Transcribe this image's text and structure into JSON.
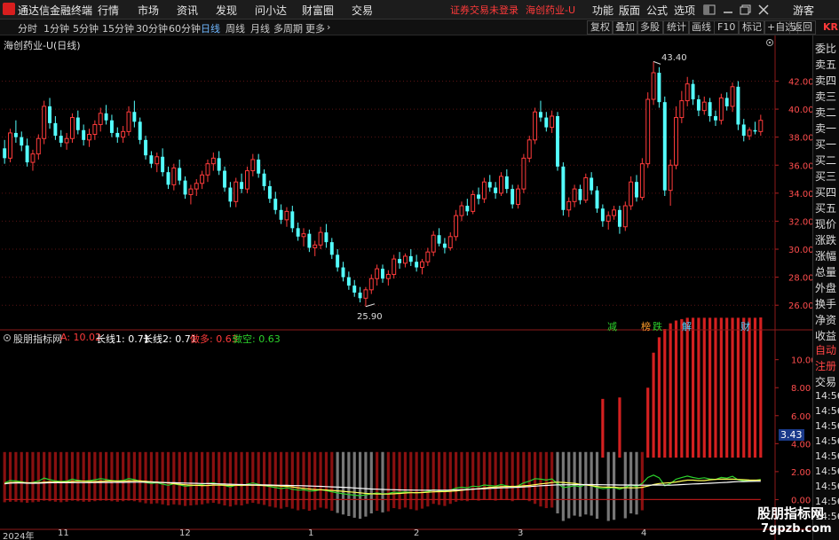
{
  "menubar": {
    "app_title": "通达信金融终端",
    "menus": [
      "行情",
      "市场",
      "资讯",
      "发现",
      "问小达",
      "财富圈",
      "交易"
    ],
    "status": "证券交易未登录",
    "stock_name": "海创药业-U",
    "right_menus": [
      "功能",
      "版面",
      "公式",
      "选项"
    ],
    "guest": "游客",
    "brand_color": "#d81e1e"
  },
  "periodbar": {
    "periods": [
      "分时",
      "1分钟",
      "5分钟",
      "15分钟",
      "30分钟",
      "60分钟",
      "日线",
      "周线",
      "月线",
      "多周期",
      "更多"
    ],
    "active_period": "日线",
    "tools": [
      "复权",
      "叠加",
      "多股",
      "统计",
      "画线",
      "F10",
      "标记",
      "+自选",
      "返回"
    ],
    "kr": "KR"
  },
  "main_chart": {
    "title": "海创药业-U(日线)",
    "high_label": "43.40",
    "low_label": "25.90",
    "event_markers": [
      "减",
      "榜",
      "跌",
      "解",
      "财"
    ],
    "up_color": "#ff3b3b",
    "down_color": "#54ffff"
  },
  "indicator": {
    "name": "股朋指标网",
    "a_label": "A: 10.02",
    "long1_label": "长线1: 0.71",
    "long2_label": "长线2: 0.71",
    "long_label": "做多: 0.63",
    "short_label": "做空: 0.63",
    "current_value": "3.43"
  },
  "x_axis": {
    "year": "2024年",
    "months": [
      "11",
      "12",
      "1",
      "2",
      "3",
      "4"
    ]
  },
  "right_panel": {
    "rows": [
      "委比",
      "卖五",
      "卖四",
      "卖三",
      "卖二",
      "卖一",
      "买一",
      "买二",
      "买三",
      "买四",
      "买五",
      "现价",
      "涨跌",
      "涨幅",
      "总量",
      "外盘",
      "换手",
      "净资",
      "收益",
      "自动",
      "注册",
      "交易",
      "14:56",
      "14:56",
      "14:56",
      "14:56",
      "14:56",
      "14:56",
      "14:56",
      "14:56",
      "14:56"
    ]
  },
  "watermark": {
    "line1": "股朋指标网",
    "line2": "7gpzb.com"
  },
  "chart_data": {
    "type": "candlestick",
    "price_axis": {
      "ticks": [
        26.0,
        28.0,
        30.0,
        32.0,
        34.0,
        36.0,
        38.0,
        40.0,
        42.0
      ],
      "ylim": [
        25.0,
        44.5
      ]
    },
    "indicator_axis": {
      "ticks": [
        0.0,
        2.0,
        4.0,
        6.0,
        8.0,
        10.0
      ],
      "ylim": [
        -2.0,
        11.5
      ]
    },
    "candles": [
      [
        37.2,
        37.8,
        36.1,
        36.5
      ],
      [
        36.5,
        38.6,
        36.2,
        38.3
      ],
      [
        38.3,
        39.2,
        37.6,
        38.0
      ],
      [
        38.0,
        38.4,
        37.0,
        37.4
      ],
      [
        37.4,
        37.9,
        35.9,
        36.2
      ],
      [
        36.2,
        37.1,
        35.6,
        36.8
      ],
      [
        36.8,
        38.2,
        36.4,
        37.9
      ],
      [
        37.9,
        40.6,
        37.5,
        40.2
      ],
      [
        40.2,
        40.8,
        38.6,
        39.0
      ],
      [
        39.0,
        39.5,
        37.8,
        38.1
      ],
      [
        38.1,
        38.5,
        37.3,
        37.6
      ],
      [
        37.6,
        38.3,
        37.1,
        37.9
      ],
      [
        37.9,
        39.7,
        37.6,
        39.4
      ],
      [
        39.4,
        39.9,
        38.2,
        38.5
      ],
      [
        38.5,
        38.9,
        37.4,
        37.8
      ],
      [
        37.8,
        38.6,
        37.3,
        38.2
      ],
      [
        38.2,
        39.2,
        37.8,
        38.9
      ],
      [
        38.9,
        40.1,
        38.4,
        39.7
      ],
      [
        39.7,
        40.3,
        38.9,
        39.2
      ],
      [
        39.2,
        39.6,
        38.0,
        38.3
      ],
      [
        38.3,
        38.7,
        37.6,
        38.0
      ],
      [
        38.0,
        38.8,
        37.6,
        38.4
      ],
      [
        38.4,
        40.2,
        38.1,
        39.8
      ],
      [
        39.8,
        40.6,
        38.7,
        39.1
      ],
      [
        39.1,
        39.4,
        37.5,
        37.8
      ],
      [
        37.8,
        38.1,
        36.4,
        36.7
      ],
      [
        36.7,
        37.0,
        35.8,
        36.1
      ],
      [
        36.1,
        36.9,
        35.5,
        36.6
      ],
      [
        36.6,
        37.2,
        35.2,
        35.5
      ],
      [
        35.5,
        35.9,
        34.3,
        34.6
      ],
      [
        34.6,
        36.1,
        34.2,
        35.8
      ],
      [
        35.8,
        36.4,
        34.6,
        34.9
      ],
      [
        34.9,
        35.2,
        33.6,
        33.9
      ],
      [
        33.9,
        34.6,
        33.2,
        34.3
      ],
      [
        34.3,
        35.0,
        33.8,
        34.7
      ],
      [
        34.7,
        35.6,
        34.3,
        35.3
      ],
      [
        35.3,
        36.4,
        34.8,
        36.1
      ],
      [
        36.1,
        36.9,
        35.6,
        36.5
      ],
      [
        36.5,
        37.0,
        35.3,
        35.6
      ],
      [
        35.6,
        35.9,
        34.1,
        34.4
      ],
      [
        34.4,
        34.8,
        33.0,
        33.4
      ],
      [
        33.4,
        35.1,
        33.0,
        34.8
      ],
      [
        34.8,
        35.4,
        34.0,
        34.3
      ],
      [
        34.3,
        35.9,
        34.0,
        35.6
      ],
      [
        35.6,
        36.8,
        35.2,
        36.4
      ],
      [
        36.4,
        36.8,
        35.1,
        35.4
      ],
      [
        35.4,
        35.7,
        34.2,
        34.5
      ],
      [
        34.5,
        34.9,
        33.3,
        33.6
      ],
      [
        33.6,
        34.1,
        32.5,
        32.8
      ],
      [
        32.8,
        33.2,
        31.8,
        32.1
      ],
      [
        32.1,
        33.0,
        31.6,
        32.7
      ],
      [
        32.7,
        33.1,
        31.2,
        31.5
      ],
      [
        31.5,
        31.9,
        30.6,
        30.9
      ],
      [
        30.9,
        31.5,
        30.2,
        31.1
      ],
      [
        31.1,
        31.4,
        29.8,
        30.1
      ],
      [
        30.1,
        30.6,
        29.5,
        30.3
      ],
      [
        30.3,
        31.6,
        30.0,
        31.2
      ],
      [
        31.2,
        31.8,
        30.1,
        30.5
      ],
      [
        30.5,
        30.8,
        29.3,
        29.6
      ],
      [
        29.6,
        30.0,
        28.4,
        28.7
      ],
      [
        28.7,
        29.1,
        27.7,
        28.0
      ],
      [
        28.0,
        28.4,
        27.1,
        27.4
      ],
      [
        27.4,
        27.8,
        26.6,
        26.9
      ],
      [
        26.9,
        27.3,
        26.2,
        26.5
      ],
      [
        26.5,
        27.3,
        25.9,
        27.1
      ],
      [
        27.1,
        28.2,
        26.8,
        27.9
      ],
      [
        27.9,
        28.9,
        27.4,
        28.6
      ],
      [
        28.6,
        28.9,
        27.6,
        27.9
      ],
      [
        27.9,
        28.5,
        27.4,
        28.2
      ],
      [
        28.2,
        29.6,
        27.9,
        29.3
      ],
      [
        29.3,
        29.8,
        28.6,
        29.0
      ],
      [
        29.0,
        29.7,
        28.7,
        29.5
      ],
      [
        29.5,
        30.0,
        28.8,
        29.1
      ],
      [
        29.1,
        29.6,
        28.4,
        28.7
      ],
      [
        28.7,
        29.3,
        28.2,
        29.1
      ],
      [
        29.1,
        30.1,
        28.8,
        29.8
      ],
      [
        29.8,
        31.3,
        29.5,
        31.0
      ],
      [
        31.0,
        31.5,
        30.2,
        30.4
      ],
      [
        30.4,
        30.8,
        29.7,
        30.1
      ],
      [
        30.1,
        31.2,
        29.9,
        30.9
      ],
      [
        30.9,
        32.8,
        30.6,
        32.4
      ],
      [
        32.4,
        33.4,
        32.0,
        33.1
      ],
      [
        33.1,
        33.6,
        32.4,
        32.7
      ],
      [
        32.7,
        34.2,
        32.5,
        33.9
      ],
      [
        33.9,
        34.4,
        33.2,
        33.6
      ],
      [
        33.6,
        35.1,
        33.3,
        34.8
      ],
      [
        34.8,
        35.3,
        34.1,
        34.4
      ],
      [
        34.4,
        34.8,
        33.6,
        34.0
      ],
      [
        34.0,
        35.5,
        33.8,
        35.2
      ],
      [
        35.2,
        35.7,
        34.0,
        34.3
      ],
      [
        34.3,
        34.6,
        32.9,
        33.2
      ],
      [
        33.2,
        34.6,
        32.9,
        34.3
      ],
      [
        34.3,
        36.8,
        34.0,
        36.5
      ],
      [
        36.5,
        38.1,
        36.2,
        37.8
      ],
      [
        37.8,
        40.1,
        37.5,
        39.8
      ],
      [
        39.8,
        40.6,
        39.1,
        39.4
      ],
      [
        39.4,
        39.8,
        38.4,
        38.7
      ],
      [
        38.7,
        39.9,
        38.3,
        39.5
      ],
      [
        39.5,
        39.8,
        35.6,
        35.9
      ],
      [
        35.9,
        36.2,
        32.4,
        32.8
      ],
      [
        32.8,
        33.7,
        32.3,
        33.4
      ],
      [
        33.4,
        34.6,
        33.0,
        34.3
      ],
      [
        34.3,
        34.6,
        33.2,
        33.5
      ],
      [
        33.5,
        35.4,
        33.3,
        35.1
      ],
      [
        35.1,
        35.5,
        33.9,
        34.2
      ],
      [
        34.2,
        34.5,
        32.6,
        32.9
      ],
      [
        32.9,
        33.2,
        31.6,
        32.0
      ],
      [
        32.0,
        32.7,
        31.4,
        32.4
      ],
      [
        32.4,
        33.1,
        32.1,
        32.8
      ],
      [
        32.8,
        33.1,
        31.1,
        31.6
      ],
      [
        31.6,
        33.4,
        31.3,
        33.1
      ],
      [
        33.1,
        35.2,
        32.8,
        34.8
      ],
      [
        34.8,
        35.3,
        33.4,
        33.7
      ],
      [
        33.7,
        36.5,
        33.5,
        36.1
      ],
      [
        36.1,
        41.2,
        35.8,
        40.7
      ],
      [
        40.7,
        43.4,
        40.3,
        42.6
      ],
      [
        42.6,
        43.0,
        40.1,
        40.5
      ],
      [
        40.5,
        40.9,
        33.8,
        34.2
      ],
      [
        34.2,
        36.4,
        33.1,
        36.0
      ],
      [
        36.0,
        40.2,
        35.7,
        39.4
      ],
      [
        39.4,
        41.3,
        39.0,
        40.6
      ],
      [
        40.6,
        42.3,
        40.2,
        41.8
      ],
      [
        41.8,
        42.1,
        40.3,
        40.7
      ],
      [
        40.7,
        41.0,
        39.5,
        39.9
      ],
      [
        39.9,
        40.9,
        39.6,
        40.5
      ],
      [
        40.5,
        40.8,
        39.1,
        39.5
      ],
      [
        39.5,
        39.9,
        38.8,
        39.2
      ],
      [
        39.2,
        41.1,
        38.9,
        40.8
      ],
      [
        40.8,
        41.2,
        39.9,
        40.2
      ],
      [
        40.2,
        41.9,
        39.8,
        41.6
      ],
      [
        41.6,
        42.0,
        38.5,
        38.9
      ],
      [
        38.9,
        39.3,
        37.7,
        38.1
      ],
      [
        38.1,
        38.7,
        37.8,
        38.5
      ],
      [
        38.5,
        39.1,
        38.2,
        38.4
      ],
      [
        38.4,
        39.6,
        38.1,
        39.2
      ]
    ],
    "indicator_a": [
      0.5,
      0.4,
      0.4,
      0.5,
      0.6,
      0.5,
      0.4,
      0.2,
      0.3,
      0.4,
      0.5,
      0.4,
      0.2,
      0.3,
      0.4,
      0.4,
      0.3,
      0.2,
      0.2,
      0.3,
      0.4,
      0.3,
      0.2,
      0.3,
      0.5,
      0.7,
      0.8,
      0.7,
      0.9,
      1.1,
      0.9,
      1.0,
      1.2,
      1.1,
      1.0,
      0.9,
      0.7,
      0.6,
      0.8,
      1.1,
      1.3,
      1.0,
      1.1,
      0.8,
      0.6,
      0.8,
      1.0,
      1.3,
      1.5,
      1.7,
      1.4,
      1.7,
      2.0,
      1.8,
      2.1,
      1.9,
      1.5,
      1.7,
      2.1,
      2.5,
      2.8,
      3.1,
      3.4,
      3.6,
      3.2,
      2.6,
      2.1,
      2.4,
      2.2,
      1.6,
      1.8,
      1.5,
      1.8,
      2.0,
      1.7,
      1.3,
      0.8,
      1.0,
      1.2,
      0.8,
      0.4,
      0.2,
      0.3,
      0.1,
      0.2,
      0.0,
      0.1,
      0.2,
      0.0,
      0.1,
      0.3,
      0.1,
      0.0,
      0.3,
      0.8,
      1.3,
      1.6,
      1.5,
      2.6,
      4.0,
      3.5,
      3.0,
      3.2,
      2.8,
      3.0,
      3.6,
      4.2,
      4.0,
      3.8,
      4.3,
      3.5,
      2.6,
      2.8,
      2.0,
      5.0,
      7.5,
      8.6,
      9.2,
      9.6,
      9.8,
      9.9,
      10.0,
      10.0,
      10.0,
      10.0,
      10.0,
      10.0,
      10.0,
      10.0,
      10.0,
      10.0,
      10.0,
      10.0,
      10.0,
      10.02
    ]
  }
}
